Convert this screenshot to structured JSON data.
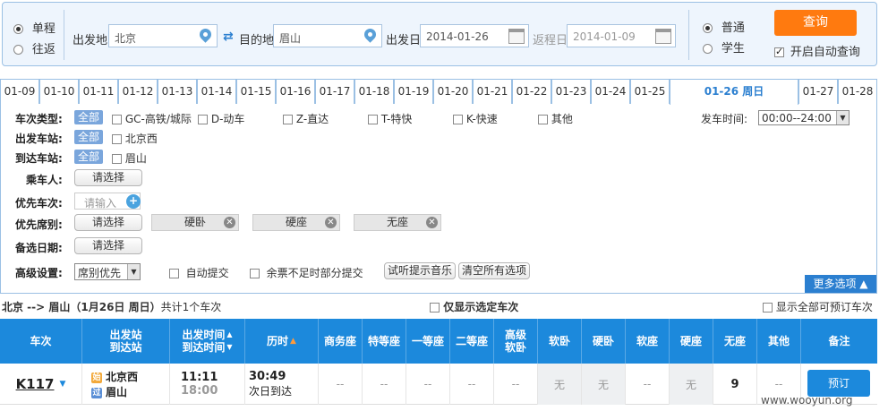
{
  "search": {
    "trip_oneway": "单程",
    "trip_round": "往返",
    "from_label": "出发地",
    "from_value": "北京",
    "to_label": "目的地",
    "to_value": "眉山",
    "depart_label": "出发日",
    "depart_value": "2014-01-26",
    "return_label": "返程日",
    "return_value": "2014-01-09",
    "type_normal": "普通",
    "type_student": "学生",
    "query_button": "查询",
    "auto_query": "开启自动查询"
  },
  "date_tabs": [
    "01-09",
    "01-10",
    "01-11",
    "01-12",
    "01-13",
    "01-14",
    "01-15",
    "01-16",
    "01-17",
    "01-18",
    "01-19",
    "01-20",
    "01-21",
    "01-22",
    "01-23",
    "01-24",
    "01-25",
    "01-26 周日",
    "01-27",
    "01-28"
  ],
  "filters": {
    "train_type_label": "车次类型:",
    "all": "全部",
    "train_types": [
      "GC-高铁/城际",
      "D-动车",
      "Z-直达",
      "T-特快",
      "K-快速",
      "其他"
    ],
    "depart_time_label": "发车时间:",
    "depart_time_value": "00:00--24:00",
    "from_station_label": "出发车站:",
    "from_station": "北京西",
    "to_station_label": "到达车站:",
    "to_station": "眉山",
    "passenger_label": "乘车人:",
    "choose": "请选择",
    "priority_train_label": "优先车次:",
    "priority_train_placeholder": "请输入",
    "priority_seat_label": "优先席别:",
    "seats": [
      "硬卧",
      "硬座",
      "无座"
    ],
    "backup_date_label": "备选日期:",
    "advanced_label": "高级设置:",
    "advanced_select": "席别优先",
    "auto_submit": "自动提交",
    "partial_submit": "余票不足时部分提交",
    "test_music": "试听提示音乐",
    "clear_all": "清空所有选项",
    "more_options": "更多选项"
  },
  "summary": {
    "route": "北京 --> 眉山（1月26日  周日）",
    "count": "共计1个车次",
    "only_selected": "仅显示选定车次",
    "show_all": "显示全部可预订车次"
  },
  "table": {
    "headers": [
      "车次",
      "出发站\n到达站",
      "出发时间\n到达时间",
      "历时",
      "商务座",
      "特等座",
      "一等座",
      "二等座",
      "高级\n软卧",
      "软卧",
      "硬卧",
      "软座",
      "硬座",
      "无座",
      "其他",
      "备注"
    ],
    "row": {
      "train": "K117",
      "from_tag": "始",
      "to_tag": "过",
      "from_station": "北京西",
      "to_station": "眉山",
      "depart_time": "11:11",
      "arrive_time": "18:00",
      "duration": "30:49",
      "arrive_day": "次日到达",
      "seats": [
        "--",
        "--",
        "--",
        "--",
        "--",
        "无",
        "无",
        "--",
        "无",
        "9",
        "--"
      ],
      "book": "预订"
    }
  },
  "watermark": "www.wooyun.org"
}
